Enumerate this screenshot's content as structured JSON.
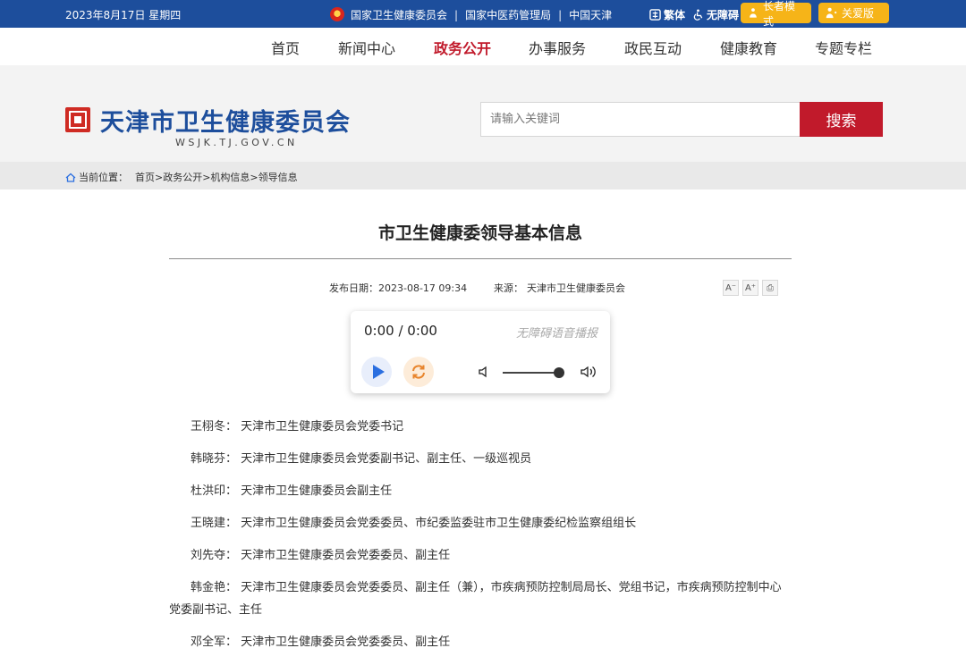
{
  "topbar": {
    "date": "2023年8月17日 星期四",
    "links": [
      "国家卫生健康委员会",
      "国家中医药管理局",
      "中国天津"
    ],
    "separator": "|",
    "tools": [
      "繁体",
      "无障碍"
    ],
    "elder_mode": "长者模式",
    "care_mode": "关爱版",
    "bar_color": "#1d4e9c",
    "pill_color": "#f6b418"
  },
  "nav": {
    "items": [
      "首页",
      "新闻中心",
      "政务公开",
      "办事服务",
      "政民互动",
      "健康教育",
      "专题专栏"
    ],
    "active": "政务公开",
    "active_color": "#c11a2b"
  },
  "header": {
    "site_name": "天津市卫生健康委员会",
    "site_domain": "WSJK.TJ.GOV.CN",
    "search_placeholder": "请输入关键词",
    "search_button": "搜索"
  },
  "breadcrumb": {
    "prefix": "当前位置：",
    "path": "首页>政务公开>机构信息>领导信息"
  },
  "article": {
    "title": "市卫生健康委领导基本信息",
    "date_label": "发布日期：",
    "date": "2023-08-17 09:34",
    "source_label": "来源：",
    "source": "天津市卫生健康委员会",
    "font_buttons": [
      "A⁻",
      "A⁺",
      "⎙"
    ]
  },
  "player": {
    "time": "0:00 / 0:00",
    "hint": "无障碍语音播报",
    "volume": 0.9
  },
  "people": [
    {
      "name": "王栩冬：",
      "title": "天津市卫生健康委员会党委书记"
    },
    {
      "name": "韩晓芬：",
      "title": "天津市卫生健康委员会党委副书记、副主任、一级巡视员"
    },
    {
      "name": "杜洪印：",
      "title": "天津市卫生健康委员会副主任"
    },
    {
      "name": "王晓建：",
      "title": "天津市卫生健康委员会党委委员、市纪委监委驻市卫生健康委纪检监察组组长"
    },
    {
      "name": "刘先夺：",
      "title": "天津市卫生健康委员会党委委员、副主任"
    },
    {
      "name": "韩金艳：",
      "title": "天津市卫生健康委员会党委委员、副主任（兼），市疾病预防控制局局长、党组书记，市疾病预防控制中心党委副书记、主任"
    },
    {
      "name": "邓全军：",
      "title": "天津市卫生健康委员会党委委员、副主任"
    }
  ]
}
